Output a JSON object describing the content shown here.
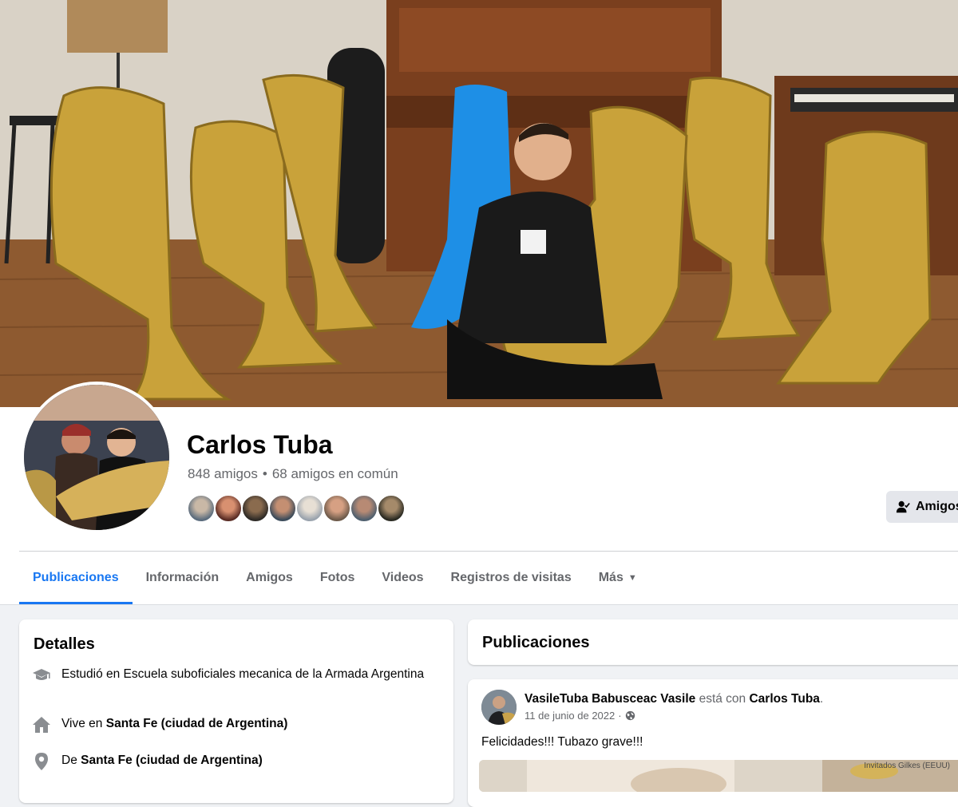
{
  "profile": {
    "name": "Carlos Tuba",
    "friends_count": "848 amigos",
    "mutual_friends": "68 amigos en común",
    "friend_button_label": "Amigos",
    "mini_avatar_count": 8
  },
  "tabs": [
    {
      "label": "Publicaciones",
      "active": true
    },
    {
      "label": "Información",
      "active": false
    },
    {
      "label": "Amigos",
      "active": false
    },
    {
      "label": "Fotos",
      "active": false
    },
    {
      "label": "Videos",
      "active": false
    },
    {
      "label": "Registros de visitas",
      "active": false
    },
    {
      "label": "Más",
      "active": false
    }
  ],
  "details": {
    "title": "Detalles",
    "items": [
      {
        "icon": "graduation-cap-icon",
        "prefix": "Estudió en Escuela suboficiales mecanica de la Armada Argentina",
        "bold": ""
      },
      {
        "icon": "home-icon",
        "prefix": "Vive en ",
        "bold": "Santa Fe (ciudad de Argentina)"
      },
      {
        "icon": "location-pin-icon",
        "prefix": "De ",
        "bold": "Santa Fe (ciudad de Argentina)"
      }
    ]
  },
  "posts": {
    "title": "Publicaciones",
    "items": [
      {
        "author": "VasileTuba Babusceac Vasile",
        "connector": " está con ",
        "tagged": "Carlos Tuba",
        "end": ".",
        "date": "11 de junio de 2022",
        "separator": "·",
        "privacy_icon": "globe-icon",
        "text": "Felicidades!!! Tubazo grave!!!",
        "media_caption": "Invitados\nGilkes (EEUU)"
      }
    ]
  },
  "colors": {
    "accent": "#1877f2",
    "background": "#f0f2f5",
    "secondary_text": "#65676b"
  }
}
